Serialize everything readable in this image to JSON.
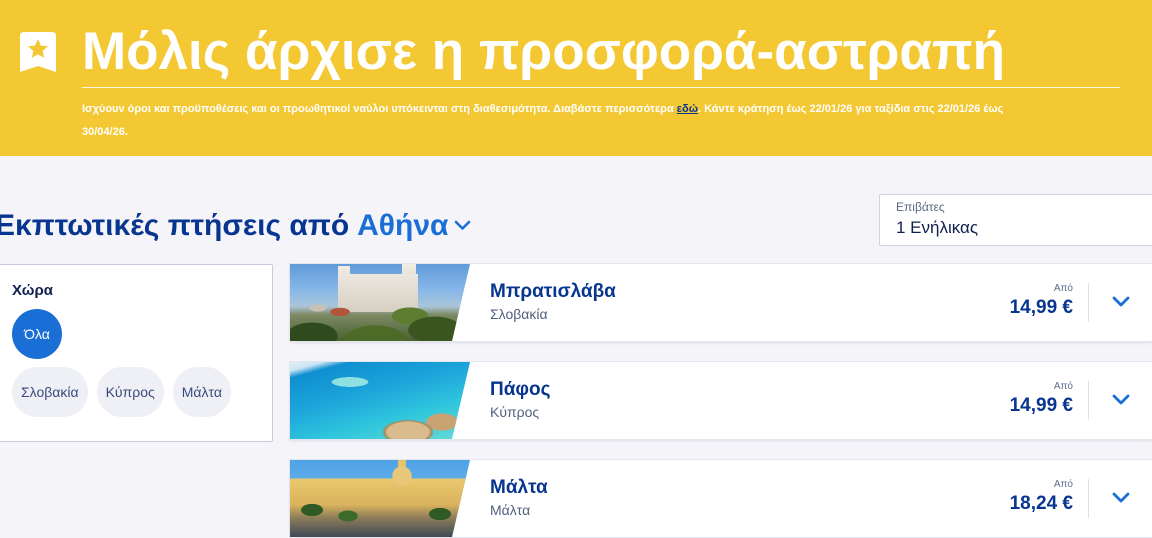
{
  "banner": {
    "icon": "star-badge-icon",
    "title": "Μόλις άρχισε η προσφορά-αστραπή",
    "terms": {
      "before": "Ισχύουν όροι και προϋποθέσεις και οι προωθητικοί ναύλοι υπόκεινται στη διαθεσιμότητα. Διαβάστε περισσότερα",
      "link": "εδώ",
      "after": ". Κάντε κράτηση έως 22/01/26 για ταξίδια στις 22/01/26 έως 30/04/26."
    }
  },
  "header": {
    "heading_prefix": "Εκπτωτικές πτήσεις από",
    "origin": "Αθήνα",
    "origin_icon": "chevron-down-icon"
  },
  "passengers": {
    "label": "Επιβάτες",
    "value": "1 Ενήλικας"
  },
  "filters": {
    "title": "Χώρα",
    "chips": [
      {
        "label": "Όλα",
        "active": true
      },
      {
        "label": "Σλοβακία",
        "active": false
      },
      {
        "label": "Κύπρος",
        "active": false
      },
      {
        "label": "Μάλτα",
        "active": false
      }
    ]
  },
  "results": [
    {
      "city": "Μπρατισλάβα",
      "country": "Σλοβακία",
      "price_prefix": "Από",
      "price": "14,99 €",
      "expand_icon": "chevron-down-icon"
    },
    {
      "city": "Πάφος",
      "country": "Κύπρος",
      "price_prefix": "Από",
      "price": "14,99 €",
      "expand_icon": "chevron-down-icon"
    },
    {
      "city": "Μάλτα",
      "country": "Μάλτα",
      "price_prefix": "Από",
      "price": "18,24 €",
      "expand_icon": "chevron-down-icon"
    }
  ],
  "colors": {
    "brand_yellow": "#F3C833",
    "navy": "#073590",
    "accent_blue": "#1A6FD7",
    "page_background": "#F4F4F9"
  }
}
